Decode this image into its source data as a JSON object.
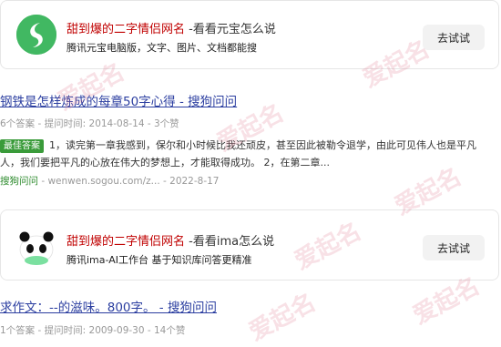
{
  "ad1": {
    "title_highlight": "甜到爆的二字情侣网名",
    "title_rest": " -看看元宝怎么说",
    "subtitle": "腾讯元宝电脑版，文字、图片、文档都能搜",
    "button_label": "去试试",
    "logo_icon": "yuanbao-logo-icon"
  },
  "result1": {
    "title": "钢铁是怎样炼成的每章50字心得 - 搜狗问问",
    "meta": "6个答案 - 提问时间: 2014-08-14 - 3个赞",
    "badge": "最佳答案",
    "best_answer": "1，读完第一章我感到，保尔和小时候比我还顽皮，甚至因此被勒令退学，由此可见伟人也是平凡人，我们要把平凡的心放在伟大的梦想上，才能取得成功。 2，在第二章...",
    "source_name": "搜狗问问",
    "source_rest": " - wenwen.sogou.com/z... - 2022-8-17"
  },
  "ad2": {
    "title_highlight": "甜到爆的二字情侣网名",
    "title_rest": " -看看ima怎么说",
    "subtitle": "腾讯ima-AI工作台 基于知识库问答更精准",
    "button_label": "去试试",
    "logo_icon": "ima-panda-logo-icon"
  },
  "result2": {
    "title": "求作文：--的滋味。800字。 - 搜狗问问",
    "meta": "1个答案 - 提问时间: 2009-09-30 - 14个赞"
  },
  "watermark": "爱起名",
  "colors": {
    "highlight": "#c00000",
    "link": "#2b3ea0",
    "badge": "#3a9b3a",
    "source": "#2b8a2b"
  }
}
